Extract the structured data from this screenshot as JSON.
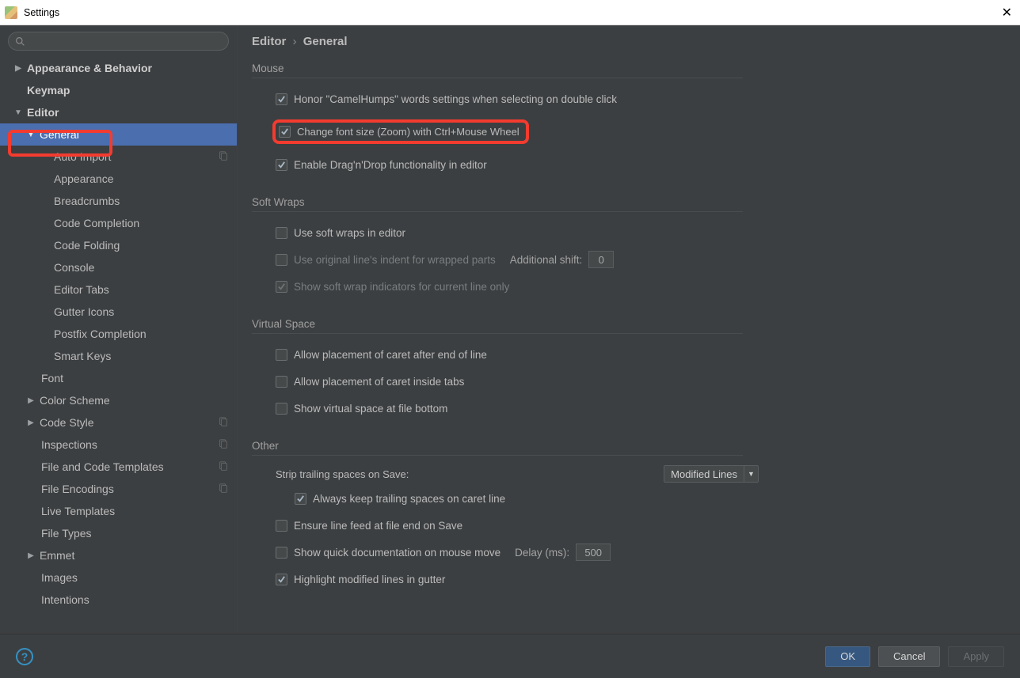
{
  "window": {
    "title": "Settings"
  },
  "search": {
    "placeholder": ""
  },
  "breadcrumb": {
    "a": "Editor",
    "sep": "›",
    "b": "General"
  },
  "tree": {
    "appearance_behavior": "Appearance & Behavior",
    "keymap": "Keymap",
    "editor": "Editor",
    "general": "General",
    "auto_import": "Auto Import",
    "appearance": "Appearance",
    "breadcrumbs": "Breadcrumbs",
    "code_completion": "Code Completion",
    "code_folding": "Code Folding",
    "console": "Console",
    "editor_tabs": "Editor Tabs",
    "gutter_icons": "Gutter Icons",
    "postfix_completion": "Postfix Completion",
    "smart_keys": "Smart Keys",
    "font": "Font",
    "color_scheme": "Color Scheme",
    "code_style": "Code Style",
    "inspections": "Inspections",
    "file_code_templates": "File and Code Templates",
    "file_encodings": "File Encodings",
    "live_templates": "Live Templates",
    "file_types": "File Types",
    "emmet": "Emmet",
    "images": "Images",
    "intentions": "Intentions"
  },
  "sections": {
    "mouse": {
      "title": "Mouse",
      "honor": "Honor \"CamelHumps\" words settings when selecting on double click",
      "zoom": "Change font size (Zoom) with Ctrl+Mouse Wheel",
      "dragdrop": "Enable Drag'n'Drop functionality in editor"
    },
    "softwraps": {
      "title": "Soft Wraps",
      "usesoft": "Use soft wraps in editor",
      "orig_indent": "Use original line's indent for wrapped parts",
      "additional_shift_label": "Additional shift:",
      "additional_shift_value": "0",
      "show_indicators": "Show soft wrap indicators for current line only"
    },
    "virtualspace": {
      "title": "Virtual Space",
      "caret_eol": "Allow placement of caret after end of line",
      "caret_tabs": "Allow placement of caret inside tabs",
      "bottom": "Show virtual space at file bottom"
    },
    "other": {
      "title": "Other",
      "strip_label": "Strip trailing spaces on Save:",
      "strip_value": "Modified Lines",
      "always_keep": "Always keep trailing spaces on caret line",
      "ensure_lf": "Ensure line feed at file end on Save",
      "quick_doc": "Show quick documentation on mouse move",
      "delay_label": "Delay (ms):",
      "delay_value": "500",
      "highlight_mod": "Highlight modified lines in gutter"
    }
  },
  "footer": {
    "ok": "OK",
    "cancel": "Cancel",
    "apply": "Apply"
  }
}
